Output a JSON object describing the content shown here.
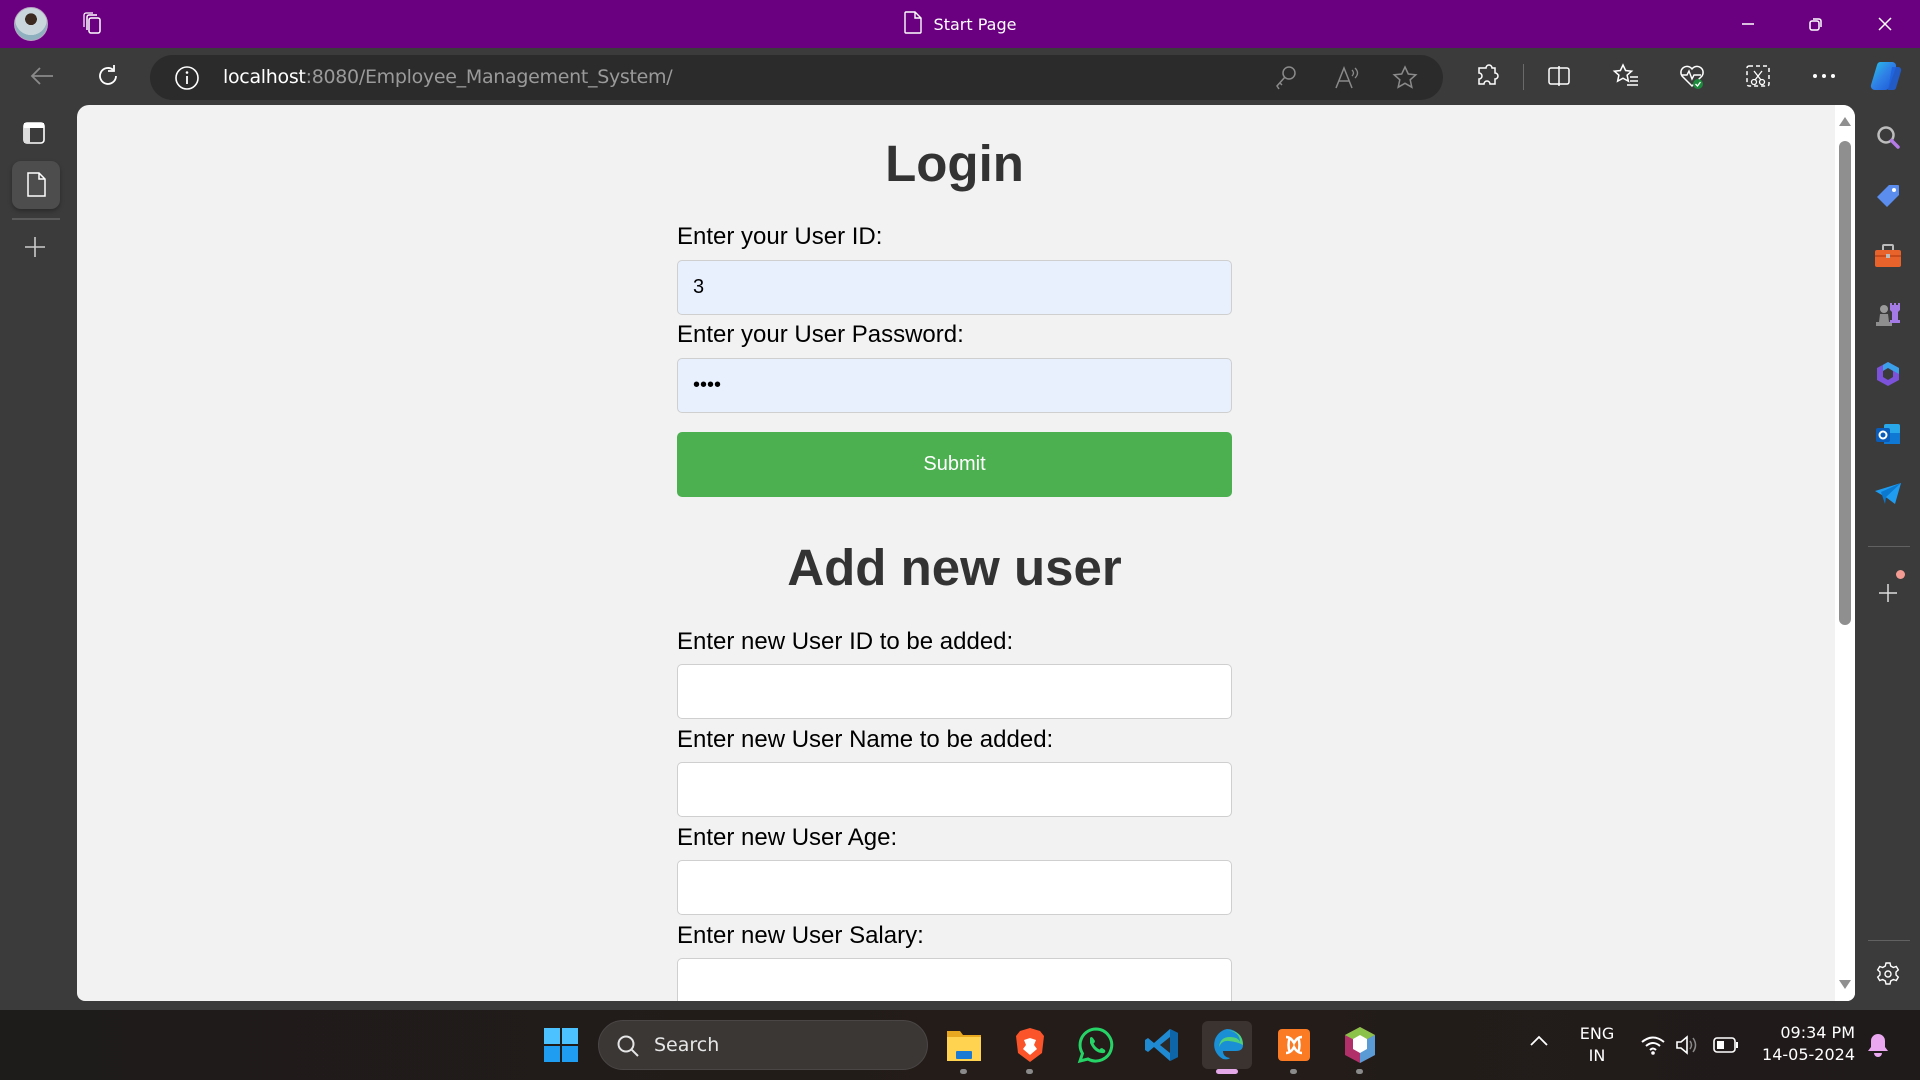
{
  "window": {
    "title": "Start Page",
    "controls": {
      "minimize": "minimize",
      "restore": "restore",
      "close": "close"
    }
  },
  "toolbar": {
    "url_host": "localhost",
    "url_rest": ":8080/Employee_Management_System/",
    "icons": [
      "back-icon",
      "refresh-icon",
      "site-info-icon",
      "password-key-icon",
      "read-aloud-icon",
      "favorite-star-icon",
      "extensions-icon",
      "split-screen-icon",
      "favorites-icon",
      "browser-essentials-icon",
      "screenshot-icon",
      "more-icon",
      "copilot-icon"
    ]
  },
  "vertical_tabs": {
    "items": [
      "tab-actions-icon",
      "start-page-tab-icon",
      "new-tab-icon"
    ]
  },
  "right_sidebar": {
    "items": [
      "search-icon",
      "shopping-tag-icon",
      "tools-icon",
      "games-icon",
      "microsoft-365-icon",
      "outlook-icon",
      "telegram-icon",
      "add-icon",
      "settings-icon"
    ]
  },
  "page": {
    "login": {
      "heading": "Login",
      "user_id_label": "Enter your User ID:",
      "user_id_value": "3",
      "password_label": "Enter your User Password:",
      "password_value": "••••",
      "submit_label": "Submit"
    },
    "add_user": {
      "heading": "Add new user",
      "fields": [
        {
          "label": "Enter new User ID to be added:",
          "value": ""
        },
        {
          "label": "Enter new User Name to be added:",
          "value": ""
        },
        {
          "label": "Enter new User Age:",
          "value": ""
        },
        {
          "label": "Enter new User Salary:",
          "value": ""
        }
      ]
    }
  },
  "colors": {
    "titlebar": "#6a0080",
    "submit_button": "#4caf50",
    "autofill_input": "#e8f0fe"
  },
  "taskbar": {
    "search_label": "Search",
    "apps": [
      "File Explorer",
      "Brave",
      "WhatsApp",
      "Visual Studio Code",
      "Microsoft Edge",
      "XAMPP",
      "NetBeans"
    ],
    "active_app": "Microsoft Edge",
    "language_line1": "ENG",
    "language_line2": "IN",
    "time": "09:34 PM",
    "date": "14-05-2024"
  }
}
